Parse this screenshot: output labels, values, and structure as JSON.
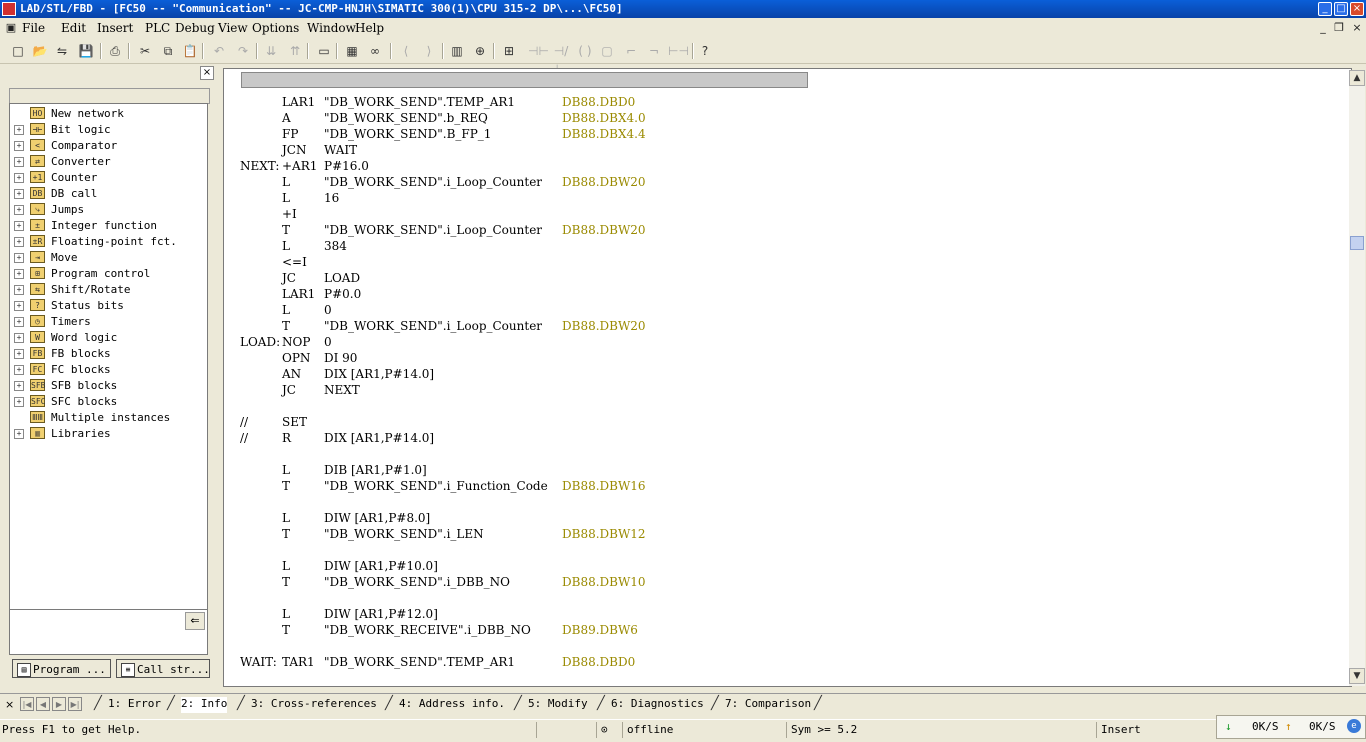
{
  "window": {
    "title": "LAD/STL/FBD  - [FC50 -- \"Communication\" -- JC-CMP-HNJH\\SIMATIC 300(1)\\CPU 315-2 DP\\...\\FC50]"
  },
  "menu": [
    "File",
    "Edit",
    "Insert",
    "PLC",
    "Debug",
    "View",
    "Options",
    "Window",
    "Help"
  ],
  "toolbar_icons": [
    "new-icon",
    "open-icon",
    "accessible-nodes-icon",
    "save-icon",
    "print-icon",
    "cut-icon",
    "copy-icon",
    "paste-icon",
    "undo-icon",
    "redo-icon",
    "download-icon",
    "upload-icon",
    "display-icon",
    "simatic-manager-icon",
    "monitor-icon",
    "previous-icon",
    "next-icon",
    "overview-icon",
    "zoom-icon",
    "network-icon",
    "contact-no-icon",
    "contact-nc-icon",
    "coil-icon",
    "empty-box-icon",
    "branch-open-icon",
    "branch-close-icon",
    "connection-icon",
    "help-icon"
  ],
  "catalog": [
    {
      "label": "New network",
      "expandable": false,
      "icon": "new-network-icon"
    },
    {
      "label": "Bit logic",
      "expandable": true,
      "icon": "bit-logic-icon"
    },
    {
      "label": "Comparator",
      "expandable": true,
      "icon": "comparator-icon"
    },
    {
      "label": "Converter",
      "expandable": true,
      "icon": "converter-icon"
    },
    {
      "label": "Counter",
      "expandable": true,
      "icon": "counter-icon"
    },
    {
      "label": "DB call",
      "expandable": true,
      "icon": "db-call-icon"
    },
    {
      "label": "Jumps",
      "expandable": true,
      "icon": "jumps-icon"
    },
    {
      "label": "Integer function",
      "expandable": true,
      "icon": "integer-function-icon"
    },
    {
      "label": "Floating-point fct.",
      "expandable": true,
      "icon": "floating-point-icon"
    },
    {
      "label": "Move",
      "expandable": true,
      "icon": "move-icon"
    },
    {
      "label": "Program control",
      "expandable": true,
      "icon": "program-control-icon"
    },
    {
      "label": "Shift/Rotate",
      "expandable": true,
      "icon": "shift-rotate-icon"
    },
    {
      "label": "Status bits",
      "expandable": true,
      "icon": "status-bits-icon"
    },
    {
      "label": "Timers",
      "expandable": true,
      "icon": "timers-icon"
    },
    {
      "label": "Word logic",
      "expandable": true,
      "icon": "word-logic-icon"
    },
    {
      "label": "FB blocks",
      "expandable": true,
      "icon": "fb-blocks-icon"
    },
    {
      "label": "FC blocks",
      "expandable": true,
      "icon": "fc-blocks-icon"
    },
    {
      "label": "SFB blocks",
      "expandable": true,
      "icon": "sfb-blocks-icon"
    },
    {
      "label": "SFC blocks",
      "expandable": true,
      "icon": "sfc-blocks-icon"
    },
    {
      "label": "Multiple instances",
      "expandable": false,
      "icon": "multiple-instances-icon"
    },
    {
      "label": "Libraries",
      "expandable": true,
      "icon": "libraries-icon"
    }
  ],
  "left_tabs": [
    "Program ...",
    "Call str..."
  ],
  "code": [
    {
      "label": "",
      "op": "LAR1",
      "arg": "\"DB_WORK_SEND\".TEMP_AR1",
      "addr": "DB88.DBD0"
    },
    {
      "label": "",
      "op": "A",
      "arg": "\"DB_WORK_SEND\".b_REQ",
      "addr": "DB88.DBX4.0"
    },
    {
      "label": "",
      "op": "FP",
      "arg": "\"DB_WORK_SEND\".B_FP_1",
      "addr": "DB88.DBX4.4"
    },
    {
      "label": "",
      "op": "JCN",
      "arg": "WAIT",
      "addr": ""
    },
    {
      "label": "NEXT:",
      "op": "+AR1",
      "arg": "P#16.0",
      "addr": ""
    },
    {
      "label": "",
      "op": "L",
      "arg": "\"DB_WORK_SEND\".i_Loop_Counter",
      "addr": "DB88.DBW20"
    },
    {
      "label": "",
      "op": "L",
      "arg": "16",
      "addr": ""
    },
    {
      "label": "",
      "op": "+I",
      "arg": "",
      "addr": ""
    },
    {
      "label": "",
      "op": "T",
      "arg": "\"DB_WORK_SEND\".i_Loop_Counter",
      "addr": "DB88.DBW20"
    },
    {
      "label": "",
      "op": "L",
      "arg": "384",
      "addr": ""
    },
    {
      "label": "",
      "op": "<=I",
      "arg": "",
      "addr": ""
    },
    {
      "label": "",
      "op": "JC",
      "arg": "LOAD",
      "addr": ""
    },
    {
      "label": "",
      "op": "LAR1",
      "arg": "P#0.0",
      "addr": ""
    },
    {
      "label": "",
      "op": "L",
      "arg": "0",
      "addr": ""
    },
    {
      "label": "",
      "op": "T",
      "arg": "\"DB_WORK_SEND\".i_Loop_Counter",
      "addr": "DB88.DBW20"
    },
    {
      "label": "LOAD:",
      "op": "NOP",
      "arg": "0",
      "addr": ""
    },
    {
      "label": "",
      "op": "OPN",
      "arg": "DI    90",
      "addr": ""
    },
    {
      "label": "",
      "op": "AN",
      "arg": "DIX [AR1,P#14.0]",
      "addr": ""
    },
    {
      "label": "",
      "op": "JC",
      "arg": "NEXT",
      "addr": ""
    },
    {
      "label": "",
      "op": "",
      "arg": "",
      "addr": ""
    },
    {
      "label": "//",
      "op": "   SET",
      "arg": "",
      "addr": ""
    },
    {
      "label": "//",
      "op": "    R",
      "arg": "     DIX [AR1,P#14.0]",
      "addr": ""
    },
    {
      "label": "",
      "op": "",
      "arg": "",
      "addr": ""
    },
    {
      "label": "",
      "op": "L",
      "arg": "DIB [AR1,P#1.0]",
      "addr": ""
    },
    {
      "label": "",
      "op": "T",
      "arg": "\"DB_WORK_SEND\".i_Function_Code",
      "addr": "DB88.DBW16"
    },
    {
      "label": "",
      "op": "",
      "arg": "",
      "addr": ""
    },
    {
      "label": "",
      "op": "L",
      "arg": "DIW [AR1,P#8.0]",
      "addr": ""
    },
    {
      "label": "",
      "op": "T",
      "arg": "\"DB_WORK_SEND\".i_LEN",
      "addr": "DB88.DBW12"
    },
    {
      "label": "",
      "op": "",
      "arg": "",
      "addr": ""
    },
    {
      "label": "",
      "op": "L",
      "arg": "DIW [AR1,P#10.0]",
      "addr": ""
    },
    {
      "label": "",
      "op": "T",
      "arg": "\"DB_WORK_SEND\".i_DBB_NO",
      "addr": "DB88.DBW10"
    },
    {
      "label": "",
      "op": "",
      "arg": "",
      "addr": ""
    },
    {
      "label": "",
      "op": "L",
      "arg": "DIW [AR1,P#12.0]",
      "addr": ""
    },
    {
      "label": "",
      "op": "T",
      "arg": "\"DB_WORK_RECEIVE\".i_DBB_NO",
      "addr": "DB89.DBW6"
    },
    {
      "label": "",
      "op": "",
      "arg": "",
      "addr": ""
    },
    {
      "label": "WAIT:",
      "op": "TAR1",
      "arg": "\"DB_WORK_SEND\".TEMP_AR1",
      "addr": "DB88.DBD0"
    }
  ],
  "bottom_tabs": [
    "1: Error",
    "2: Info",
    "3: Cross-references",
    "4: Address info.",
    "5: Modify",
    "6: Diagnostics",
    "7: Comparison"
  ],
  "status": {
    "help": "Press F1 to get Help.",
    "mode": "offline",
    "version": "Sym >= 5.2",
    "insert": "Insert",
    "down_rate": "0K/S",
    "up_rate": "0K/S"
  },
  "colors": {
    "title_bar": "#0a5fd8",
    "address_text": "#9a8a00",
    "chrome": "#ece9d8"
  }
}
